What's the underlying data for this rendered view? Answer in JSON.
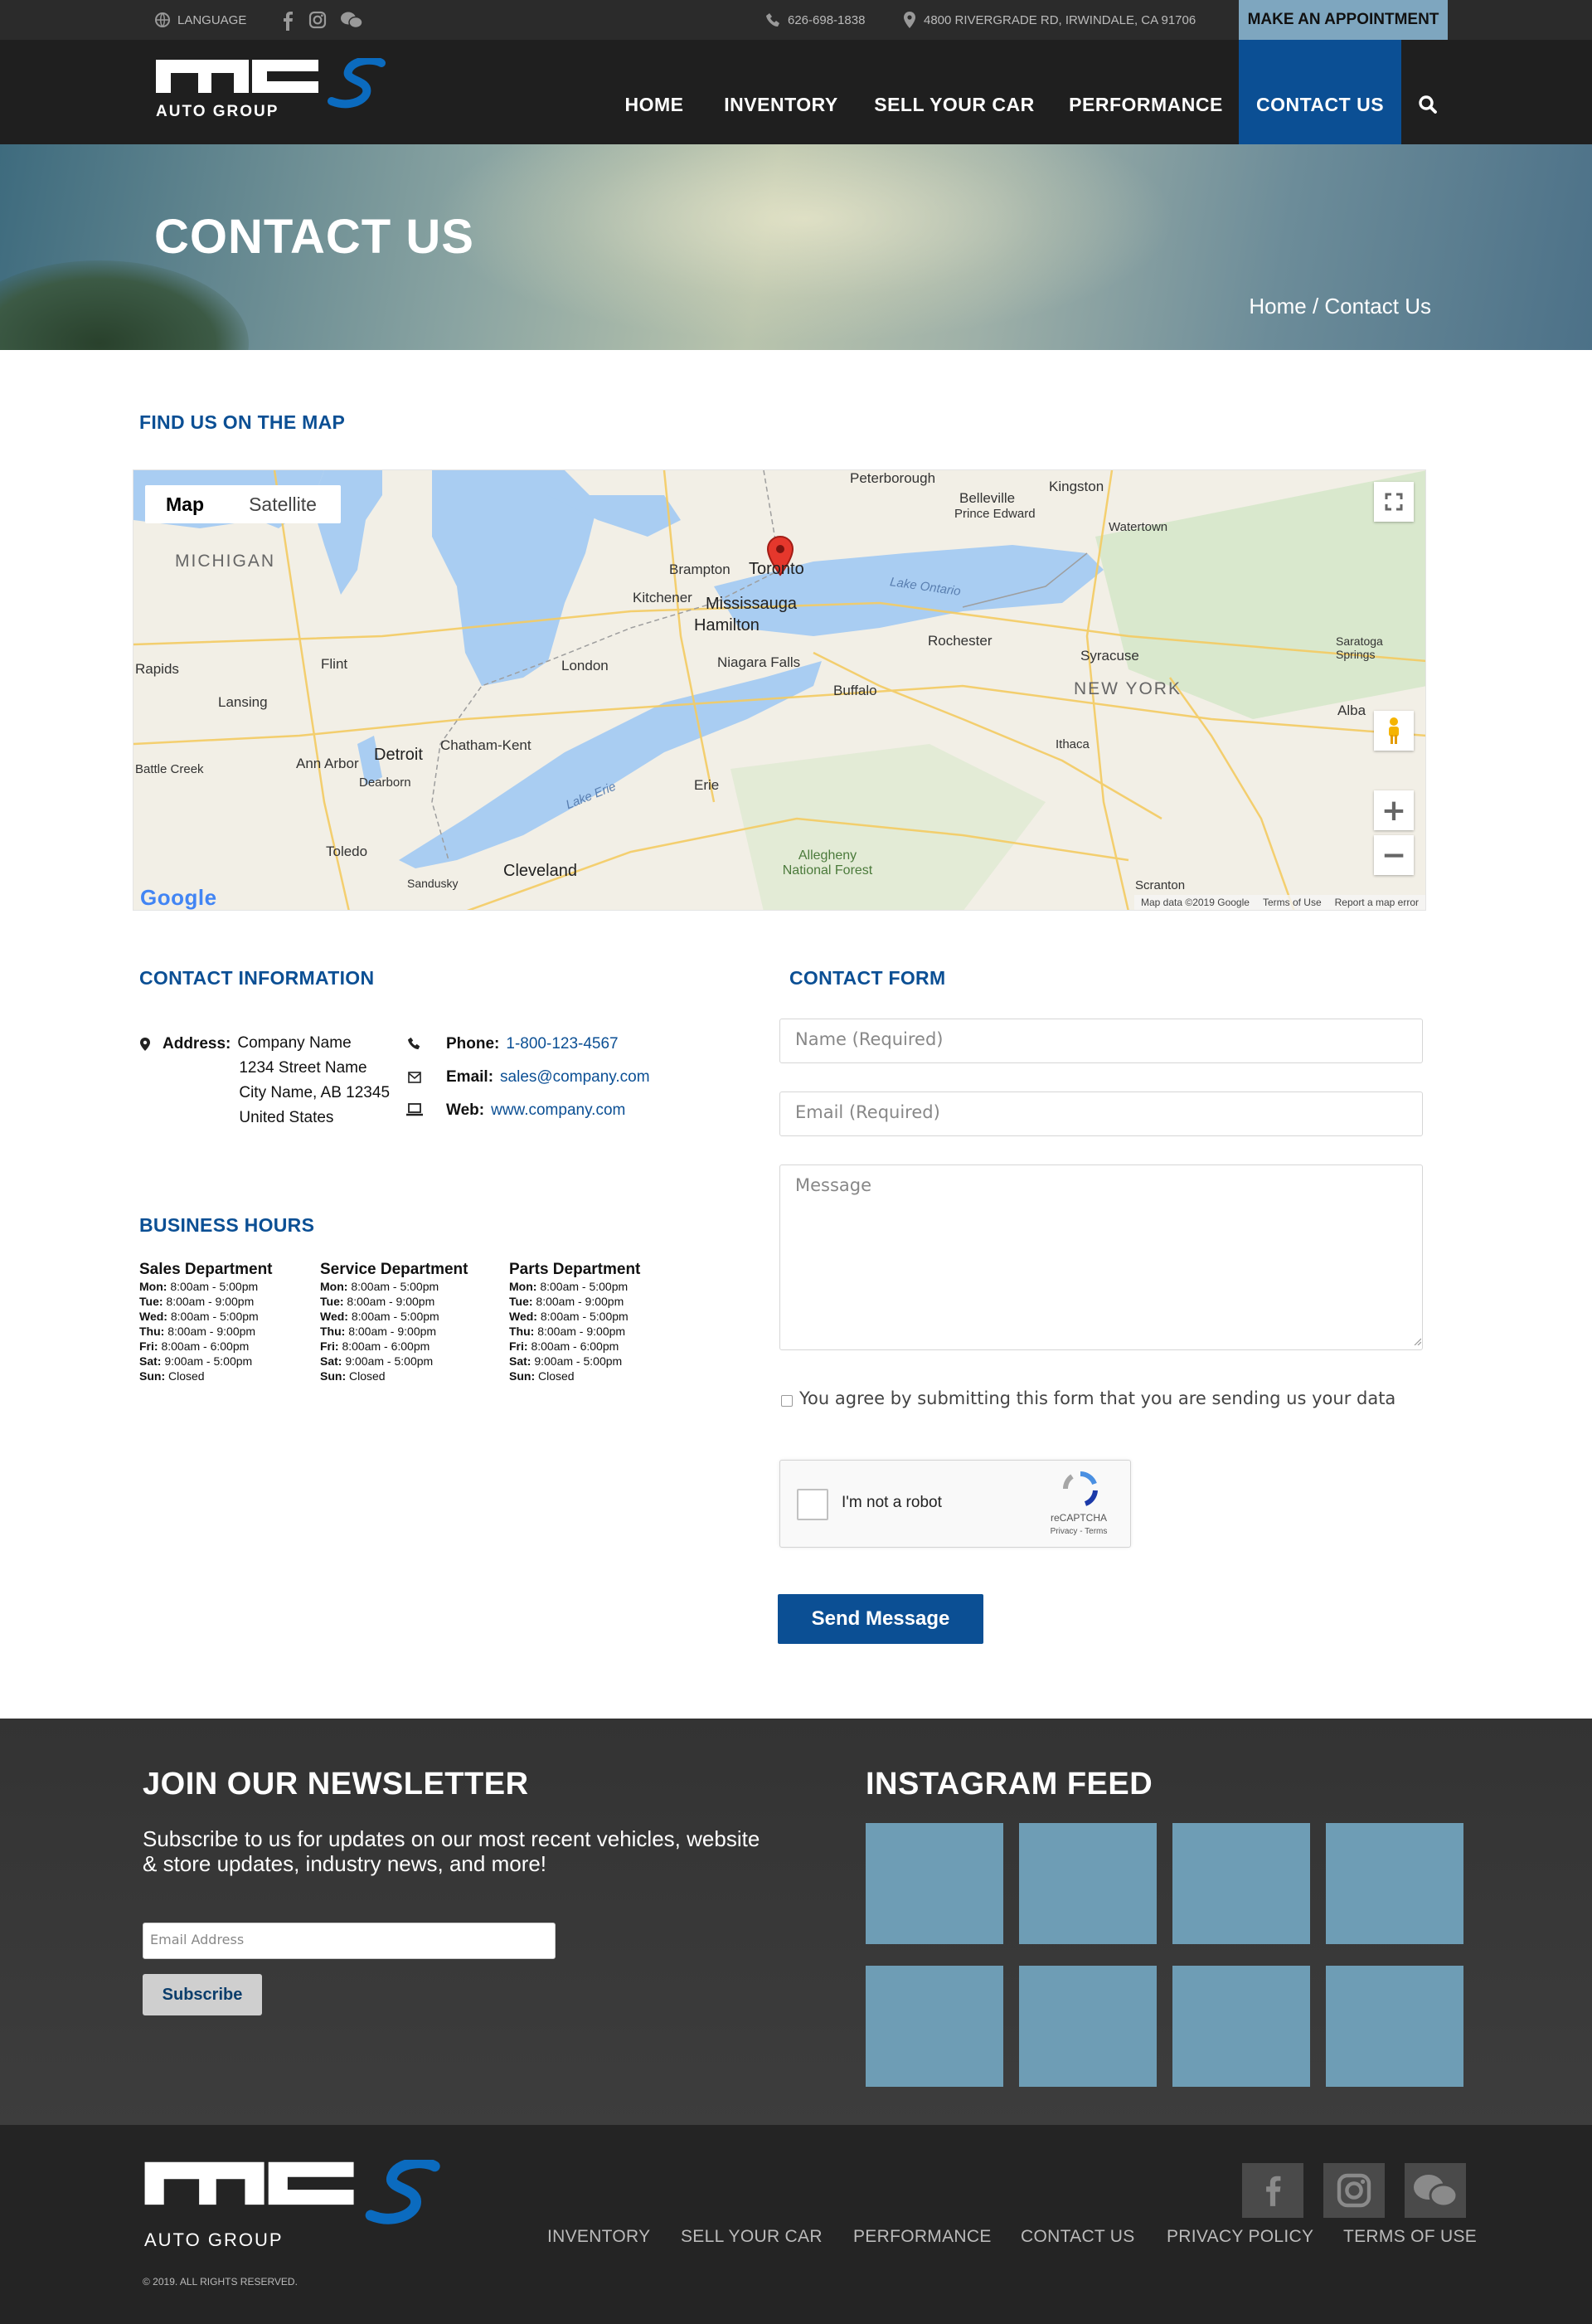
{
  "topbar": {
    "language": "LANGUAGE",
    "phone": "626-698-1838",
    "address": "4800 RIVERGRADE RD, IRWINDALE, CA 91706",
    "appointment": "MAKE AN APPOINTMENT"
  },
  "brand": {
    "logo_text": "MCS",
    "logo_sub": "AUTO GROUP"
  },
  "nav": {
    "items": [
      "HOME",
      "INVENTORY",
      "SELL YOUR CAR",
      "PERFORMANCE",
      "CONTACT US"
    ],
    "active": "CONTACT US"
  },
  "hero": {
    "title": "CONTACT US",
    "breadcrumb": "Home / Contact Us"
  },
  "map": {
    "heading": "FIND US ON THE MAP",
    "type_buttons": [
      "Map",
      "Satellite"
    ],
    "selected_type": "Map",
    "labels": {
      "michigan": "MICHIGAN",
      "new_york": "NEW YORK",
      "toronto": "Toronto",
      "brampton": "Brampton",
      "mississauga": "Mississauga",
      "hamilton": "Hamilton",
      "kitchener": "Kitchener",
      "london": "London",
      "niagara": "Niagara Falls",
      "buffalo": "Buffalo",
      "rochester": "Rochester",
      "syracuse": "Syracuse",
      "detroit": "Detroit",
      "toledo": "Toledo",
      "cleveland": "Cleveland",
      "erie": "Erie",
      "ann_arbor": "Ann Arbor",
      "lansing": "Lansing",
      "flint": "Flint",
      "kingston": "Kingston",
      "peterborough": "Peterborough",
      "belleville": "Belleville",
      "ithaca": "Ithaca",
      "scranton": "Scranton",
      "chatham": "Chatham-Kent",
      "lake_ontario": "Lake Ontario",
      "lake_erie": "Lake Erie",
      "allegheny": "Allegheny National Forest",
      "battle_creek": "Battle Creek",
      "rapids": "Rapids",
      "watertown": "Watertown",
      "albany": "Alba",
      "saratoga": "Saratoga Springs",
      "prince_edward": "Prince Edward",
      "dearborn": "Dearborn",
      "sandusky": "Sandusky"
    },
    "attribution": "Map data ©2019 Google",
    "terms": "Terms of Use",
    "report": "Report a map error",
    "google": "Google"
  },
  "contact_info": {
    "heading": "CONTACT INFORMATION",
    "address_label": "Address:",
    "address_lines": [
      "Company Name",
      "1234 Street Name",
      "City Name, AB 12345",
      "United States"
    ],
    "phone_label": "Phone:",
    "phone": "1-800-123-4567",
    "email_label": "Email:",
    "email": "sales@company.com",
    "web_label": "Web:",
    "web": "www.company.com"
  },
  "hours": {
    "heading": "BUSINESS HOURS",
    "departments": [
      {
        "name": "Sales Department",
        "rows": [
          [
            "Mon:",
            "8:00am - 5:00pm"
          ],
          [
            "Tue:",
            "8:00am - 9:00pm"
          ],
          [
            "Wed:",
            "8:00am - 5:00pm"
          ],
          [
            "Thu:",
            "8:00am - 9:00pm"
          ],
          [
            "Fri:",
            "8:00am - 6:00pm"
          ],
          [
            "Sat:",
            "9:00am - 5:00pm"
          ],
          [
            "Sun:",
            "Closed"
          ]
        ]
      },
      {
        "name": "Service Department",
        "rows": [
          [
            "Mon:",
            "8:00am - 5:00pm"
          ],
          [
            "Tue:",
            "8:00am - 9:00pm"
          ],
          [
            "Wed:",
            "8:00am - 5:00pm"
          ],
          [
            "Thu:",
            "8:00am - 9:00pm"
          ],
          [
            "Fri:",
            "8:00am - 6:00pm"
          ],
          [
            "Sat:",
            "9:00am - 5:00pm"
          ],
          [
            "Sun:",
            "Closed"
          ]
        ]
      },
      {
        "name": "Parts Department",
        "rows": [
          [
            "Mon:",
            "8:00am - 5:00pm"
          ],
          [
            "Tue:",
            "8:00am - 9:00pm"
          ],
          [
            "Wed:",
            "8:00am - 5:00pm"
          ],
          [
            "Thu:",
            "8:00am - 9:00pm"
          ],
          [
            "Fri:",
            "8:00am - 6:00pm"
          ],
          [
            "Sat:",
            "9:00am - 5:00pm"
          ],
          [
            "Sun:",
            "Closed"
          ]
        ]
      }
    ]
  },
  "form": {
    "heading": "CONTACT FORM",
    "name_placeholder": "Name (Required)",
    "email_placeholder": "Email (Required)",
    "message_placeholder": "Message",
    "consent": "You agree by submitting this form that you are sending us your data",
    "recaptcha_label": "I'm not a robot",
    "recaptcha_brand": "reCAPTCHA",
    "recaptcha_links": "Privacy - Terms",
    "submit": "Send Message"
  },
  "newsletter": {
    "heading": "JOIN OUR NEWSLETTER",
    "text": "Subscribe to us for updates on our most recent vehicles, website & store updates, industry news, and more!",
    "placeholder": "Email Address",
    "button": "Subscribe"
  },
  "instagram": {
    "heading": "INSTAGRAM FEED",
    "tile_count": 8
  },
  "footer": {
    "links": [
      "INVENTORY",
      "SELL YOUR CAR",
      "PERFORMANCE",
      "CONTACT US",
      "PRIVACY POLICY",
      "TERMS OF USE"
    ],
    "copyright": "© 2019. ALL RIGHTS RESERVED."
  },
  "colors": {
    "brand_blue": "#0b4f94",
    "appointment": "#7ea6bf",
    "insta_tile": "#6e9db5"
  },
  "icons": [
    "globe-icon",
    "facebook-icon",
    "instagram-icon",
    "wechat-icon",
    "phone-icon",
    "map-pin-icon",
    "search-icon",
    "fullscreen-icon",
    "pegman-icon",
    "zoom-in-icon",
    "zoom-out-icon",
    "map-marker-icon",
    "envelope-icon",
    "laptop-icon",
    "recaptcha-icon"
  ]
}
